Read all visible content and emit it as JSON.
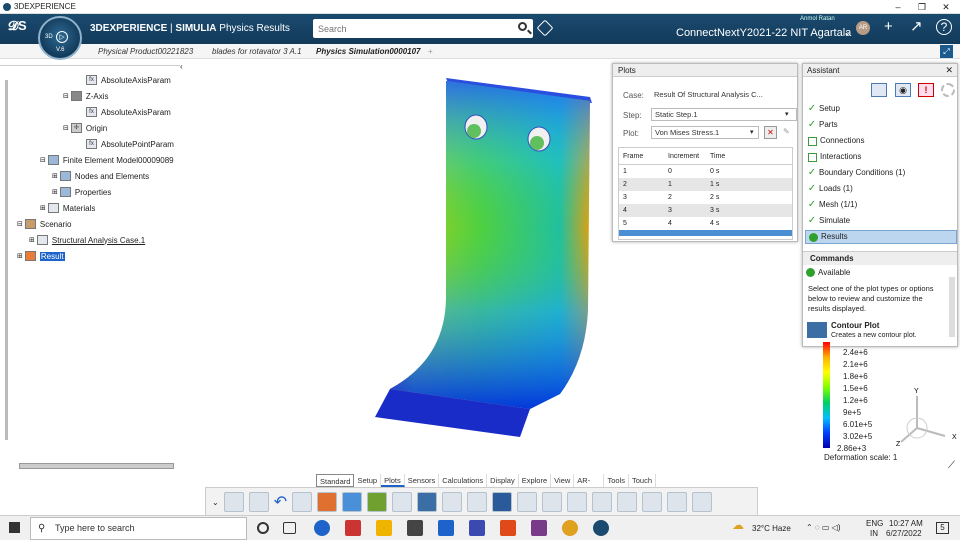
{
  "window": {
    "title": "3DEXPERIENCE"
  },
  "header": {
    "brand_prefix": "3DEXPERIENCE",
    "brand_app": "SIMULIA",
    "brand_suffix": "Physics Results",
    "compass_label": "3D",
    "compass_version": "V.6",
    "search_placeholder": "Search",
    "user_name": "Anmol Ratan",
    "avatar_initials": "AR",
    "organization": "ConnectNextY2021-22 NIT Agartala"
  },
  "tabs": [
    {
      "label": "Physical Product00221823",
      "active": false
    },
    {
      "label": "blades for rotavator 3 A.1",
      "active": false
    },
    {
      "label": "Physics Simulation0000107",
      "active": true
    }
  ],
  "tree": [
    {
      "label": "AbsoluteAxisParam",
      "icon": "parameter-icon"
    },
    {
      "label": "Z-Axis",
      "icon": "axis-icon"
    },
    {
      "label": "AbsoluteAxisParam",
      "icon": "parameter-icon"
    },
    {
      "label": "Origin",
      "icon": "origin-icon"
    },
    {
      "label": "AbsolutePointParam",
      "icon": "parameter-icon"
    },
    {
      "label": "Finite Element Model00009089",
      "icon": "fem-icon"
    },
    {
      "label": "Nodes and Elements",
      "icon": "nodes-icon"
    },
    {
      "label": "Properties",
      "icon": "properties-icon"
    },
    {
      "label": "Materials",
      "icon": "materials-icon"
    },
    {
      "label": "Scenario",
      "icon": "scenario-icon"
    },
    {
      "label": "Structural Analysis Case.1",
      "icon": "analysis-case-icon"
    },
    {
      "label": "Result",
      "icon": "result-icon"
    }
  ],
  "plots": {
    "title": "Plots",
    "case_label": "Case:",
    "case_value": "Result Of Structural Analysis C...",
    "step_label": "Step:",
    "step_value": "Static Step.1",
    "plot_label": "Plot:",
    "plot_value": "Von Mises Stress.1",
    "columns": [
      "Frame",
      "Increment",
      "Time"
    ],
    "rows": [
      [
        "1",
        "0",
        "0 s"
      ],
      [
        "2",
        "1",
        "1 s"
      ],
      [
        "3",
        "2",
        "2 s"
      ],
      [
        "4",
        "3",
        "3 s"
      ],
      [
        "5",
        "4",
        "4 s"
      ]
    ]
  },
  "assistant": {
    "title": "Assistant",
    "steps": [
      {
        "label": "Setup",
        "state": "done"
      },
      {
        "label": "Parts",
        "state": "done"
      },
      {
        "label": "Connections",
        "state": "empty"
      },
      {
        "label": "Interactions",
        "state": "empty"
      },
      {
        "label": "Boundary Conditions (1)",
        "state": "done"
      },
      {
        "label": "Loads (1)",
        "state": "done"
      },
      {
        "label": "Mesh (1/1)",
        "state": "done"
      },
      {
        "label": "Simulate",
        "state": "done"
      },
      {
        "label": "Results",
        "state": "current"
      }
    ],
    "commands_title": "Commands",
    "available_label": "Available",
    "description": "Select one of the plot types or options below to review and customize the results displayed.",
    "contour_title": "Contour Plot",
    "contour_desc": "Creates a new contour plot."
  },
  "legend": {
    "values": [
      "2.4e+6",
      "2.1e+6",
      "1.8e+6",
      "1.5e+6",
      "1.2e+6",
      "9e+5",
      "6.01e+5",
      "3.02e+5",
      "2.86e+3"
    ],
    "deformation": "Deformation scale: 1",
    "colors": [
      "#ff0000",
      "#ffb000",
      "#ffff00",
      "#80ff00",
      "#00d060",
      "#00c0ff",
      "#0040ff",
      "#0000b0"
    ]
  },
  "axes": {
    "y": "Y",
    "x": "X",
    "z": "Z"
  },
  "bottom_tabs": [
    "Standard",
    "Setup",
    "Plots",
    "Sensors",
    "Calculations",
    "Display",
    "Explore",
    "View",
    "AR-VR",
    "Tools",
    "Touch"
  ],
  "active_bottom_tab": "Plots",
  "taskbar": {
    "search_placeholder": "Type here to search",
    "weather": "32°C  Haze",
    "language": "ENG",
    "region": "IN",
    "time": "10:27 AM",
    "date": "6/27/2022",
    "notifications": "5"
  }
}
